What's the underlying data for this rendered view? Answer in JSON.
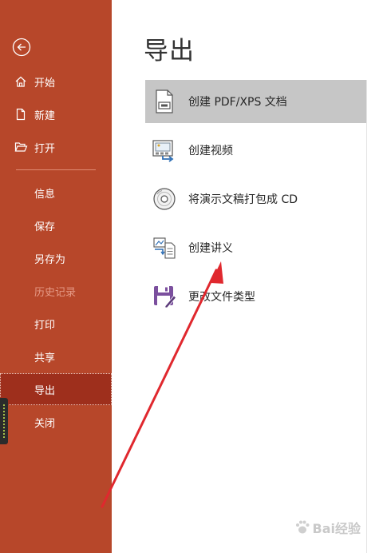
{
  "sidebar": {
    "items": [
      {
        "label": "开始",
        "icon": "home-icon"
      },
      {
        "label": "新建",
        "icon": "new-document-icon"
      },
      {
        "label": "打开",
        "icon": "folder-open-icon"
      },
      {
        "label": "信息"
      },
      {
        "label": "保存"
      },
      {
        "label": "另存为"
      },
      {
        "label": "历史记录",
        "state": "disabled"
      },
      {
        "label": "打印"
      },
      {
        "label": "共享"
      },
      {
        "label": "导出",
        "state": "selected"
      },
      {
        "label": "关闭"
      }
    ]
  },
  "main": {
    "title": "导出",
    "options": [
      {
        "label": "创建 PDF/XPS 文档",
        "icon": "pdf-document-icon",
        "state": "selected"
      },
      {
        "label": "创建视频",
        "icon": "video-icon"
      },
      {
        "label": "将演示文稿打包成 CD",
        "icon": "cd-icon"
      },
      {
        "label": "创建讲义",
        "icon": "handout-icon"
      },
      {
        "label": "更改文件类型",
        "icon": "save-as-type-icon"
      }
    ]
  },
  "watermark": {
    "text": "Bai经验"
  },
  "colors": {
    "sidebar_bg": "#b7472a",
    "sidebar_selected": "#9e2f1c",
    "sidebar_disabled_text": "#e59a86",
    "option_selected_bg": "#c6c6c6",
    "annotation_arrow": "#e0282e"
  }
}
